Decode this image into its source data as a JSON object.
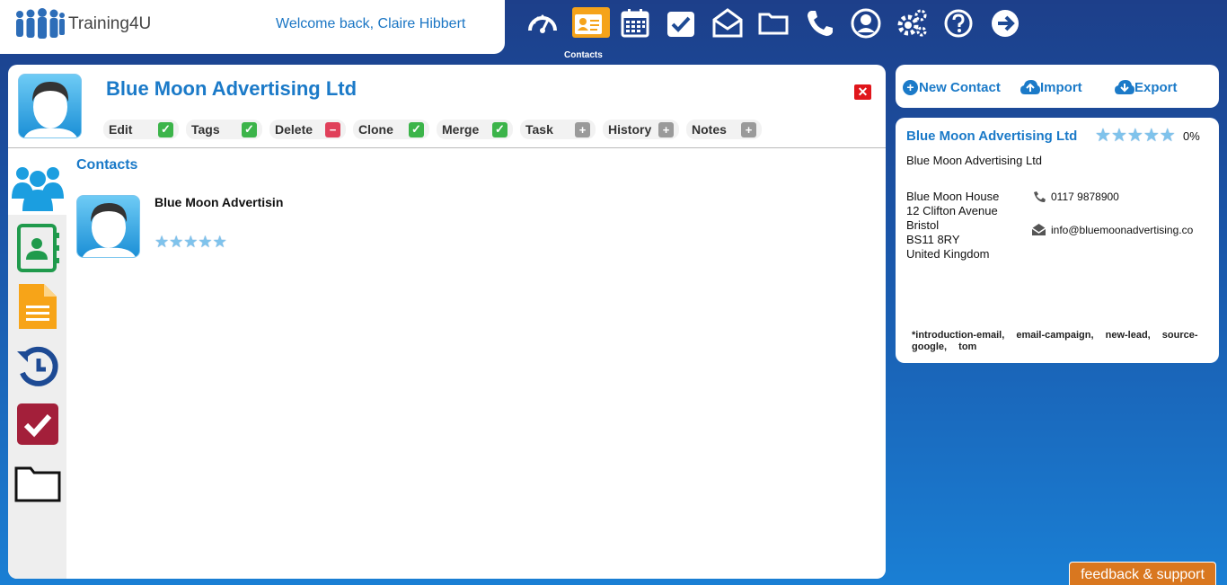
{
  "header": {
    "app_name": "Training4U",
    "welcome": "Welcome back, Claire Hibbert",
    "active_nav_label": "Contacts",
    "nav_icons": [
      "dashboard-icon",
      "contacts-icon",
      "calendar-icon",
      "tasks-icon",
      "mail-icon",
      "folder-icon",
      "phone-icon",
      "user-icon",
      "settings-icon",
      "help-icon",
      "logout-icon"
    ]
  },
  "record": {
    "title": "Blue Moon Advertising Ltd",
    "actions": [
      {
        "label": "Edit",
        "icon": "check"
      },
      {
        "label": "Tags",
        "icon": "check"
      },
      {
        "label": "Delete",
        "icon": "minus"
      },
      {
        "label": "Clone",
        "icon": "check"
      },
      {
        "label": "Merge",
        "icon": "check"
      },
      {
        "label": "Task",
        "icon": "plus"
      },
      {
        "label": "History",
        "icon": "plus"
      },
      {
        "label": "Notes",
        "icon": "plus"
      }
    ]
  },
  "contacts_section": {
    "heading": "Contacts",
    "contact_name": "Blue Moon Advertisin",
    "rating": 5
  },
  "toolbar": {
    "new_contact": "New Contact",
    "import": "Import",
    "export": "Export"
  },
  "details": {
    "title": "Blue Moon Advertising Ltd",
    "completion": "0%",
    "company": "Blue Moon Advertising Ltd",
    "address": [
      "Blue Moon House",
      "12 Clifton Avenue",
      "Bristol",
      "BS11 8RY",
      "United Kingdom"
    ],
    "phone": "0117 9878900",
    "email": "info@bluemoonadvertising.co",
    "tags": [
      "*introduction-email,",
      "email-campaign,",
      "new-lead,",
      "source-google,",
      "tom"
    ]
  },
  "feedback": "feedback & support",
  "colors": {
    "accent": "#1b7ac8",
    "active_nav": "#f5a31a",
    "feedback": "#d9771f"
  }
}
